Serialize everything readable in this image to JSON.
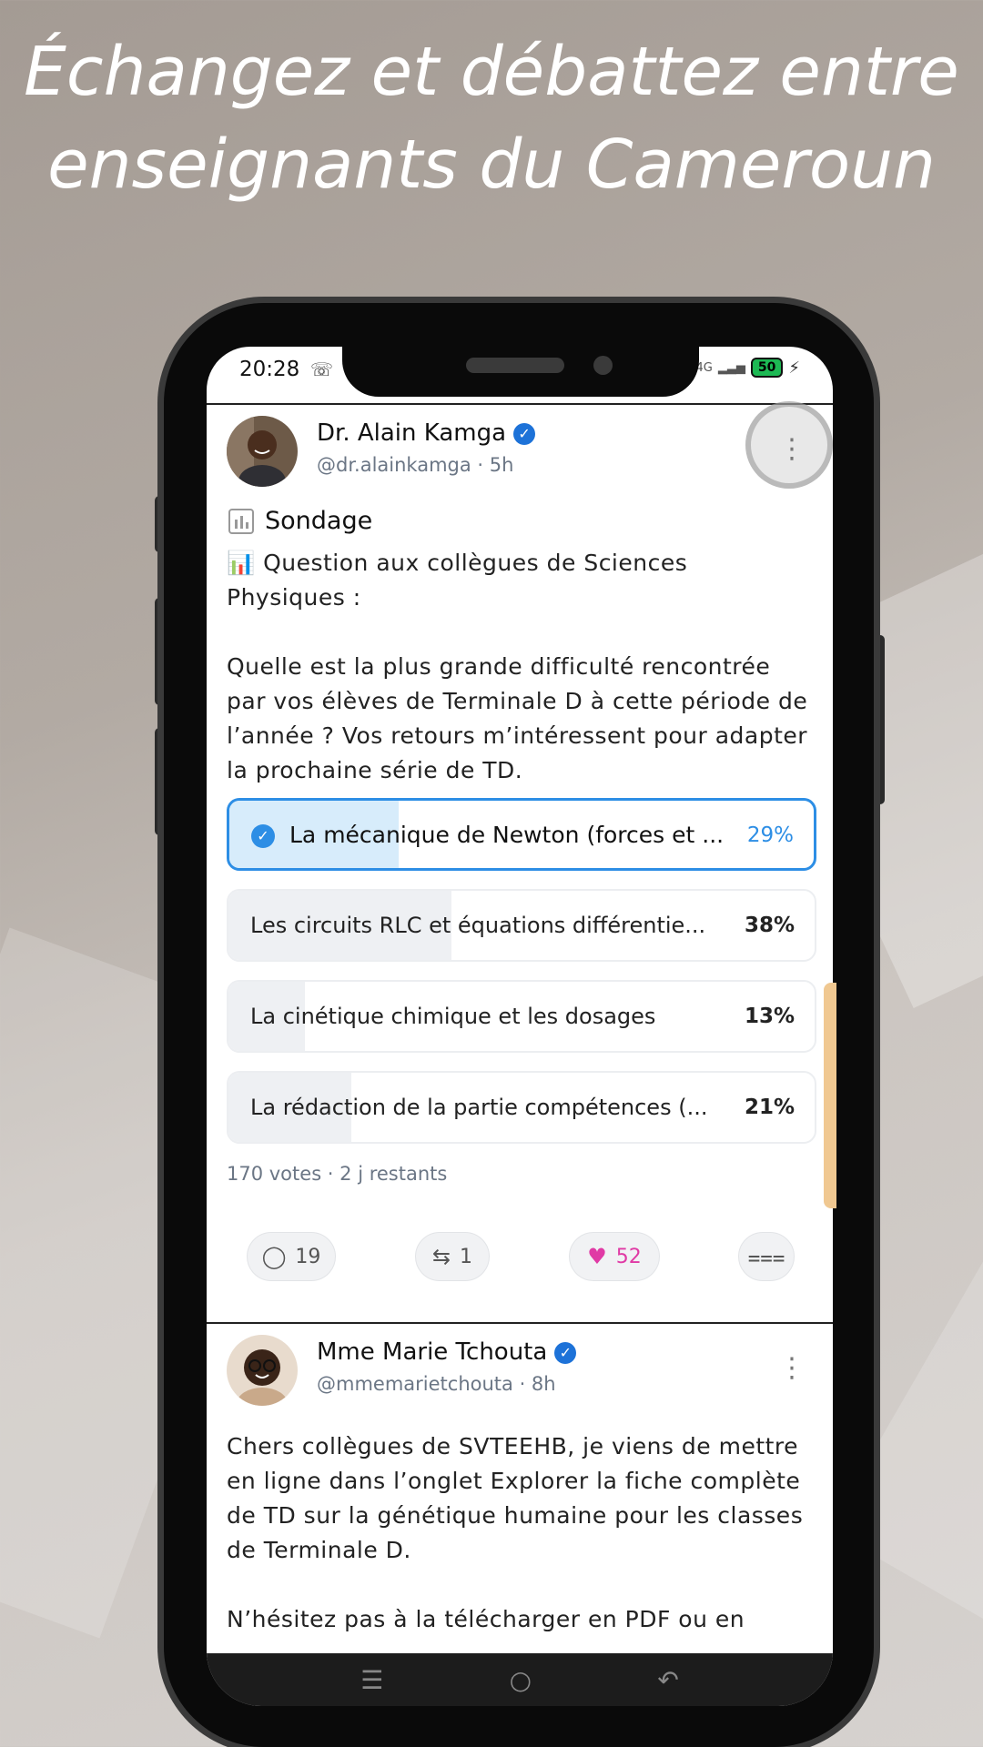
{
  "headline": {
    "line1": "Échangez et débattez entre",
    "line2": "enseignants du Cameroun"
  },
  "status_bar": {
    "time": "20:28",
    "network": "4G",
    "battery": "50"
  },
  "posts": [
    {
      "author": "Dr. Alain Kamga",
      "handle": "@dr.alainkamga · 5h",
      "verified": true,
      "type_label": "Sondage",
      "text_line1": "📊 Question aux collègues de Sciences Physiques :",
      "text_line2": "Quelle est la plus grande difficulté rencontrée par vos élèves de Terminale D à cette période de l’année ? Vos retours m’intéressent pour adapter la prochaine série de TD.",
      "poll": {
        "options": [
          {
            "label": "La mécanique de Newton (forces et ...",
            "percent_label": "29%",
            "percent": 29,
            "selected": true
          },
          {
            "label": "Les circuits RLC et équations différentie...",
            "percent_label": "38%",
            "percent": 38,
            "selected": false
          },
          {
            "label": "La cinétique chimique et les dosages",
            "percent_label": "13%",
            "percent": 13,
            "selected": false
          },
          {
            "label": "La rédaction de la partie compétences (...",
            "percent_label": "21%",
            "percent": 21,
            "selected": false
          }
        ],
        "meta": "170 votes · 2 j restants"
      },
      "actions": {
        "comments": "19",
        "reposts": "1",
        "likes": "52",
        "liked": true
      }
    },
    {
      "author": "Mme Marie Tchouta",
      "handle": "@mmemarietchouta · 8h",
      "verified": true,
      "text_line1": "Chers collègues de SVTEEHB, je viens de mettre en ligne dans l’onglet Explorer la fiche complète de TD sur la génétique humaine pour les classes de Terminale D.",
      "text_line2": "N’hésitez pas à la télécharger en PDF ou en"
    }
  ],
  "icons": {
    "more": "more-vertical-icon",
    "comment": "comment-icon",
    "repost": "repost-icon",
    "like": "heart-icon",
    "share": "share-icon",
    "poll": "poll-icon"
  },
  "colors": {
    "accent": "#2d8ee5",
    "like": "#e03aa5",
    "verified": "#1d72d8"
  }
}
